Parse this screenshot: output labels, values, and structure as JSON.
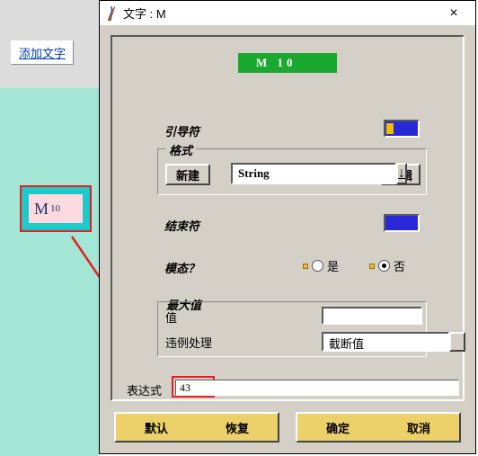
{
  "add_text_button": "添加文字",
  "selection": {
    "letter": "M",
    "num": "10"
  },
  "dialog": {
    "title": "文字 : M",
    "header_tag": "M  10",
    "lead_char": "引导符",
    "format": {
      "title": "格式",
      "new_btn": "新建",
      "type": "String",
      "edit_btn": "编辑"
    },
    "end_char": "结束符",
    "modal": {
      "label": "模态？",
      "yes": "是",
      "no": "否",
      "value": "no"
    },
    "max": {
      "title": "最大值",
      "value_label": "值",
      "value": "",
      "violation_label": "违例处理",
      "violation_value": "截断值"
    },
    "expression": {
      "label": "表达式",
      "value": "43"
    },
    "buttons": {
      "default": "默认",
      "restore": "恢复",
      "ok": "确定",
      "cancel": "取消"
    }
  }
}
